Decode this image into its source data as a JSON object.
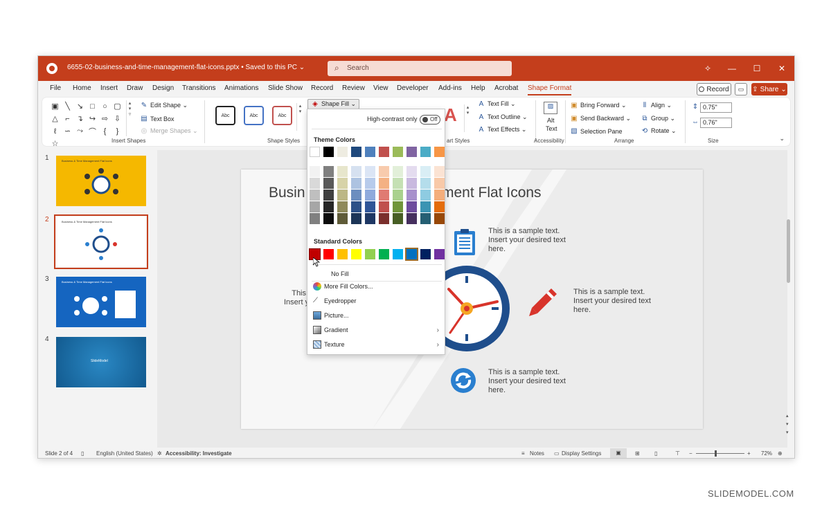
{
  "titlebar": {
    "doc_title": "6655-02-business-and-time-management-flat-icons.pptx • Saved to this PC ⌄",
    "search_placeholder": "Search"
  },
  "tabs": [
    "File",
    "Home",
    "Insert",
    "Draw",
    "Design",
    "Transitions",
    "Animations",
    "Slide Show",
    "Record",
    "Review",
    "View",
    "Developer",
    "Add-ins",
    "Help",
    "Acrobat",
    "Shape Format"
  ],
  "tab_buttons": {
    "record": "Record",
    "share": "Share"
  },
  "ribbon": {
    "insert_shapes_label": "Insert Shapes",
    "edit_shape": "Edit Shape ⌄",
    "text_box": "Text Box",
    "merge_shapes": "Merge Shapes ⌄",
    "shape_styles_label": "Shape Styles",
    "style_sample": "Abc",
    "shape_fill": "Shape Fill ⌄",
    "wordart_label": "art Styles",
    "text_fill": "Text Fill ⌄",
    "text_outline": "Text Outline ⌄",
    "text_effects": "Text Effects ⌄",
    "alt_text_line1": "Alt",
    "alt_text_line2": "Text",
    "accessibility_label": "Accessibility",
    "bring_forward": "Bring Forward ⌄",
    "send_backward": "Send Backward ⌄",
    "selection_pane": "Selection Pane",
    "align": "Align ⌄",
    "group": "Group ⌄",
    "rotate": "Rotate ⌄",
    "arrange_label": "Arrange",
    "height": "0.75\"",
    "width": "0.76\"",
    "size_label": "Size"
  },
  "slides": [
    {
      "number": "1",
      "title": "Business & Time Management Flat Icons",
      "bg": "#f5b800"
    },
    {
      "number": "2",
      "title": "Business & Time Management Flat Icons",
      "bg": "#ffffff"
    },
    {
      "number": "3",
      "title": "Business & Time Management Flat Icons",
      "bg": "#1565c0"
    },
    {
      "number": "4",
      "title": "SlideModel",
      "bg": "#1976b5"
    }
  ],
  "slide": {
    "title_left": "Busin",
    "title_right": "ment Flat Icons",
    "text_top": [
      "This is a sample text.",
      "Insert your desired text",
      "here."
    ],
    "text_right": [
      "This is a sample text.",
      "Insert your desired text",
      "here."
    ],
    "text_bottom": [
      "This is a sample text.",
      "Insert your desired text",
      "here."
    ],
    "text_left": [
      "This",
      "Insert y"
    ]
  },
  "status": {
    "slide_count": "Slide 2 of 4",
    "language": "English (United States)",
    "accessibility": "Accessibility: Investigate",
    "notes": "Notes",
    "display_settings": "Display Settings",
    "zoom": "72%"
  },
  "dropdown": {
    "high_contrast": "High-contrast only",
    "toggle_state": "Off",
    "theme_colors_label": "Theme Colors",
    "standard_colors_label": "Standard Colors",
    "theme_top": [
      "#ffffff",
      "#000000",
      "#e7e6e6",
      "#44546a",
      "#4472c4",
      "#ed7d31",
      "#a5a5a5",
      "#ffc000",
      "#5b9bd5",
      "#70ad47"
    ],
    "theme_columns": [
      [
        "#f2f2f2",
        "#d9d9d9",
        "#bfbfbf",
        "#a6a6a6",
        "#808080"
      ],
      [
        "#808080",
        "#595959",
        "#404040",
        "#262626",
        "#0d0d0d"
      ],
      [
        "#e7e6cc",
        "#d7d3a8",
        "#bcb785",
        "#8f8a5a",
        "#5f5b38"
      ],
      [
        "#d6e1f0",
        "#adc3e1",
        "#6c8ebf",
        "#2c5188",
        "#1c3557"
      ],
      [
        "#dbe5f5",
        "#b7cbeb",
        "#8faadc",
        "#2f5597",
        "#1f3864"
      ],
      [
        "#f8cbad",
        "#f4b183",
        "#e07b72",
        "#c0504d",
        "#7a2f2c"
      ],
      [
        "#e2efd9",
        "#c5e0b4",
        "#a9d18e",
        "#70953a",
        "#485f25"
      ],
      [
        "#e4dcef",
        "#c9b9df",
        "#a791cc",
        "#6e4c9d",
        "#46305f"
      ],
      [
        "#d9eef5",
        "#b4ddeb",
        "#8ecbe1",
        "#3b94b3",
        "#255f73"
      ],
      [
        "#fbe3d3",
        "#f8c9a8",
        "#f4ae7c",
        "#e46c0a",
        "#984807"
      ]
    ],
    "theme_top_actual": [
      "#ffffff",
      "#000000",
      "#eeece1",
      "#1f497d",
      "#4f81bd",
      "#c0504d",
      "#9bbb59",
      "#8064a2",
      "#4bacc6",
      "#f79646"
    ],
    "standard": [
      "#c00000",
      "#ff0000",
      "#ffc000",
      "#ffff00",
      "#92d050",
      "#00b050",
      "#00b0f0",
      "#0070c0",
      "#002060",
      "#7030a0"
    ],
    "no_fill": "No Fill",
    "more_fill": "More Fill Colors...",
    "eyedropper": "Eyedropper",
    "picture": "Picture...",
    "gradient": "Gradient",
    "texture": "Texture"
  },
  "colors": {
    "accent": "#c43e1c",
    "clock_blue": "#1f4e8c",
    "icon_blue": "#2a7fcf",
    "pencil_red": "#d8342b"
  },
  "watermark": "SLIDEMODEL.COM"
}
